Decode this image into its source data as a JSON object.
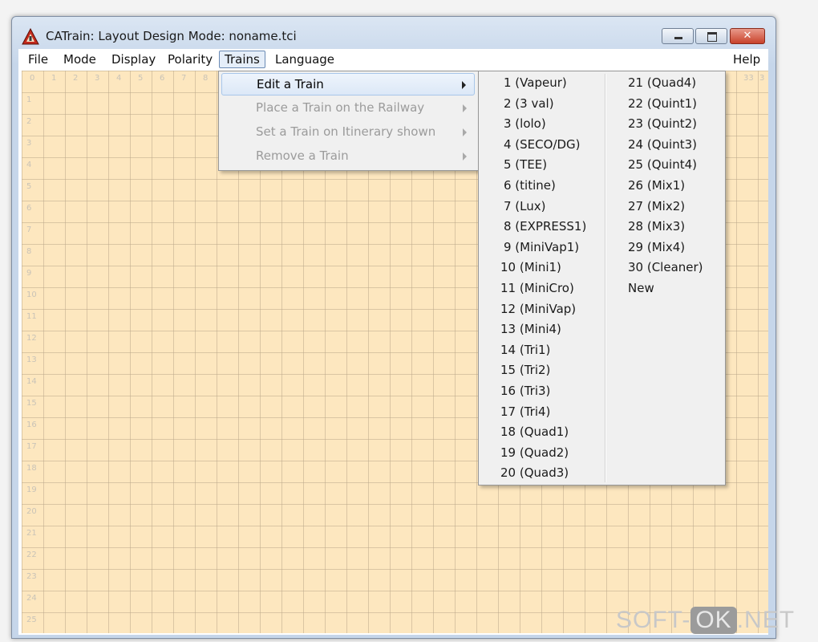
{
  "window": {
    "title": "CATrain: Layout Design Mode: noname.tci",
    "close_glyph": "✕"
  },
  "menubar": {
    "file": "File",
    "mode": "Mode",
    "display": "Display",
    "polarity": "Polarity",
    "trains": "Trains",
    "language": "Language",
    "help": "Help"
  },
  "grid": {
    "row_labels": [
      "1",
      "2",
      "3",
      "4",
      "5",
      "6",
      "7",
      "8",
      "9",
      "10",
      "11",
      "12",
      "13",
      "14",
      "15",
      "16",
      "17",
      "18",
      "19",
      "20",
      "21",
      "22",
      "23",
      "24",
      "25"
    ],
    "col_labels": [
      "0",
      "1",
      "2",
      "3",
      "4",
      "5",
      "6",
      "7",
      "8"
    ],
    "col_labels_right": [
      "33",
      "3"
    ]
  },
  "trains_menu": {
    "items": [
      {
        "label": "Edit a Train",
        "enabled": true
      },
      {
        "label": "Place a Train on the Railway",
        "enabled": false
      },
      {
        "label": "Set a Train on Itinerary shown",
        "enabled": false
      },
      {
        "label": "Remove a Train",
        "enabled": false
      }
    ]
  },
  "edit_train_submenu": {
    "col1": [
      "1 (Vapeur)",
      "2 (3 val)",
      "3 (lolo)",
      "4 (SECO/DG)",
      "5 (TEE)",
      "6 (titine)",
      "7 (Lux)",
      "8 (EXPRESS1)",
      "9 (MiniVap1)",
      "10 (Mini1)",
      "11 (MiniCro)",
      "12 (MiniVap)",
      "13 (Mini4)",
      "14 (Tri1)",
      "15 (Tri2)",
      "16 (Tri3)",
      "17 (Tri4)",
      "18 (Quad1)",
      "19 (Quad2)",
      "20 (Quad3)"
    ],
    "col2": [
      "21 (Quad4)",
      "22 (Quint1)",
      "23 (Quint2)",
      "24 (Quint3)",
      "25 (Quint4)",
      "26 (Mix1)",
      "27 (Mix2)",
      "28 (Mix3)",
      "29 (Mix4)",
      "30 (Cleaner)",
      "New"
    ]
  },
  "watermark": {
    "part1": "SOFT-",
    "part2": "OK",
    "part3": ".NET"
  }
}
